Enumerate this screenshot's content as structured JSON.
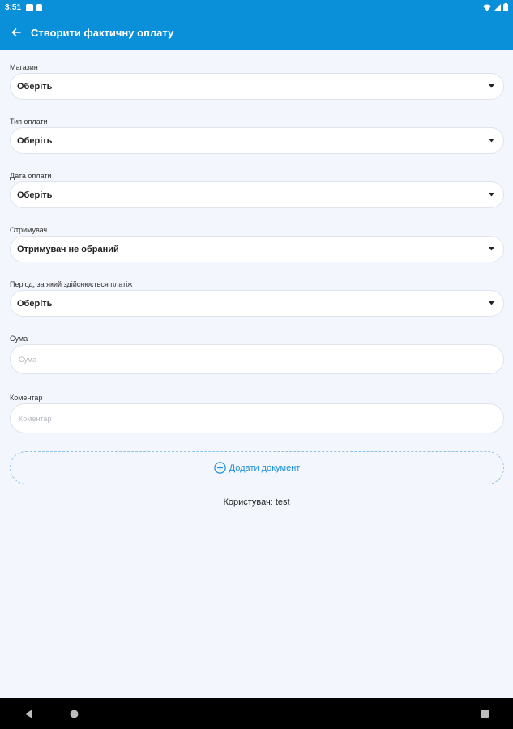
{
  "status_bar": {
    "time": "3:51"
  },
  "app_bar": {
    "title": "Створити фактичну оплату"
  },
  "form": {
    "store": {
      "label": "Магазин",
      "value": "Оберіть"
    },
    "payment_type": {
      "label": "Тип оплати",
      "value": "Оберіть"
    },
    "payment_date": {
      "label": "Дата оплати",
      "value": "Оберіть"
    },
    "recipient": {
      "label": "Отримувач",
      "value": "Отримувач не обраний"
    },
    "period": {
      "label": "Період, за який здійснюється платіж",
      "value": "Оберіть"
    },
    "amount": {
      "label": "Сума",
      "placeholder": "Сума",
      "value": ""
    },
    "comment": {
      "label": "Коментар",
      "placeholder": "Коментар",
      "value": ""
    }
  },
  "add_document": {
    "label": "Додати документ"
  },
  "user_line": "Користувач: test",
  "colors": {
    "primary": "#0a8fd9",
    "background": "#f3f6fd",
    "accent_text": "#1e8fd8"
  }
}
